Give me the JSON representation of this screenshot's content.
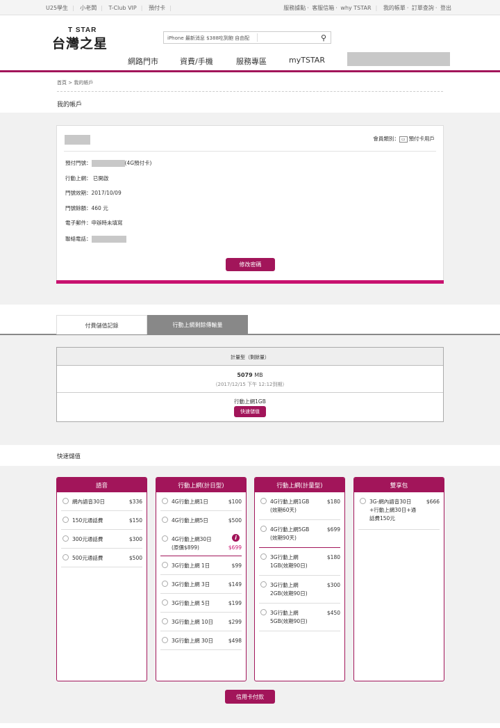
{
  "topbar": {
    "left": [
      "U25學生",
      "小老闆",
      "T-Club VIP",
      "預付卡"
    ],
    "right": [
      "服務據點",
      "客服信箱",
      "why TSTAR",
      "我的帳單",
      "訂單查詢",
      "登出"
    ]
  },
  "header": {
    "logo_top": "T STAR",
    "logo_main": "台灣之星",
    "search_placeholder": "iPhone 最新消息  $388吃到飽  自由配",
    "nav": [
      "網路門市",
      "資費/手機",
      "服務專區",
      "myTSTAR"
    ]
  },
  "breadcrumb": "首頁 > 我的帳戶",
  "page_title": "我的帳戶",
  "account": {
    "member_type_label": "會員類別：",
    "member_type": "預付卡用戶",
    "prepaid_label": "預付門號：",
    "prepaid_suffix": "(4G預付卡)",
    "mobile_label": "行動上網：",
    "mobile_value": "已開啟",
    "expiry_label": "門號效期：",
    "expiry_value": "2017/10/09",
    "balance_label": "門號餘額：",
    "balance_value": "460 元",
    "email_label": "電子郵件：",
    "email_value": "申辦時未填寫",
    "phone_label": "聯絡電話：",
    "change_pwd": "修改密碼"
  },
  "tabs": [
    "付費儲值記錄",
    "行動上網剩餘傳輸量"
  ],
  "usage": {
    "header": "計量型（剩餘量）",
    "amount": "5079",
    "unit": "MB",
    "expiry": "（2017/12/15 下午 12:12到期）",
    "plan": "行動上網1GB",
    "quick": "快速儲值"
  },
  "quick_title": "快速儲值",
  "columns": [
    {
      "title": "語音",
      "items": [
        {
          "name": "網內語音30日",
          "price": "$336"
        },
        {
          "name": "150元通話費",
          "price": "$150"
        },
        {
          "name": "300元通話費",
          "price": "$300"
        },
        {
          "name": "500元通話費",
          "price": "$500"
        }
      ]
    },
    {
      "title": "行動上網(計日型)",
      "items": [
        {
          "name": "4G行動上網1日",
          "price": "$100"
        },
        {
          "name": "4G行動上網5日",
          "price": "$500"
        },
        {
          "name": "4G行動上網30日",
          "name2": "(原價$899)",
          "price": "$699"
        },
        {
          "name": "3G行動上網 1日",
          "price": "$99"
        },
        {
          "name": "3G行動上網 3日",
          "price": "$149"
        },
        {
          "name": "3G行動上網 5日",
          "price": "$199"
        },
        {
          "name": "3G行動上網 10日",
          "price": "$299"
        },
        {
          "name": "3G行動上網 30日",
          "price": "$498"
        }
      ]
    },
    {
      "title": "行動上網(計量型)",
      "items": [
        {
          "name": "4G行動上網1GB",
          "name2": "(效期60天)",
          "price": "$180"
        },
        {
          "name": "4G行動上網5GB",
          "name2": "(效期90天)",
          "price": "$699"
        },
        {
          "name": "3G行動上網",
          "name2": "1GB(效期90日)",
          "price": "$180"
        },
        {
          "name": "3G行動上網",
          "name2": "2GB(效期90日)",
          "price": "$300"
        },
        {
          "name": "3G行動上網",
          "name2": "5GB(效期90日)",
          "price": "$450"
        }
      ]
    },
    {
      "title": "雙享包",
      "items": [
        {
          "name": "3G-網內語音30日",
          "name2": "+行動上網30日+通",
          "name3": "話費150元",
          "price": "$666"
        }
      ]
    }
  ],
  "pay_button": "信用卡付款",
  "colors": {
    "brand": "#a2155a",
    "accent": "#c8126f"
  }
}
